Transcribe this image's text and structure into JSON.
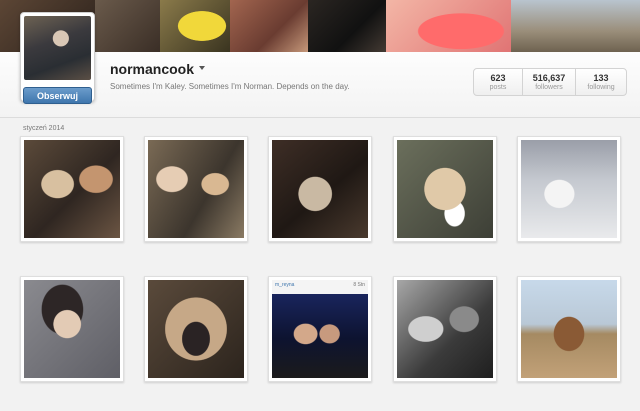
{
  "profile": {
    "username": "normancook",
    "bio": "Sometimes I'm Kaley. Sometimes I'm Norman. Depends on the day.",
    "follow_label": "Obserwuj"
  },
  "stats": {
    "posts": {
      "value": "623",
      "label": "posts"
    },
    "followers": {
      "value": "516,637",
      "label": "followers"
    },
    "following": {
      "value": "133",
      "label": "following"
    }
  },
  "feed": {
    "date_label": "styczeń 2014",
    "photos": [
      {
        "name": "photo-dog-kiss"
      },
      {
        "name": "photo-girls-selfie"
      },
      {
        "name": "photo-dog-sleeping"
      },
      {
        "name": "photo-dog-closeup"
      },
      {
        "name": "photo-runway-white-dress"
      },
      {
        "name": "photo-woman-portrait"
      },
      {
        "name": "photo-dog-nose"
      },
      {
        "name": "photo-couple-party",
        "overlay_user": "m_reyna",
        "overlay_time": "8 Stn"
      },
      {
        "name": "photo-bw-couple"
      },
      {
        "name": "photo-horse-rider"
      }
    ]
  },
  "colors": {
    "follow_button": "#3f76ad",
    "background": "#f2f2f2"
  },
  "icons": {
    "username_menu": "chevron-down-icon"
  }
}
